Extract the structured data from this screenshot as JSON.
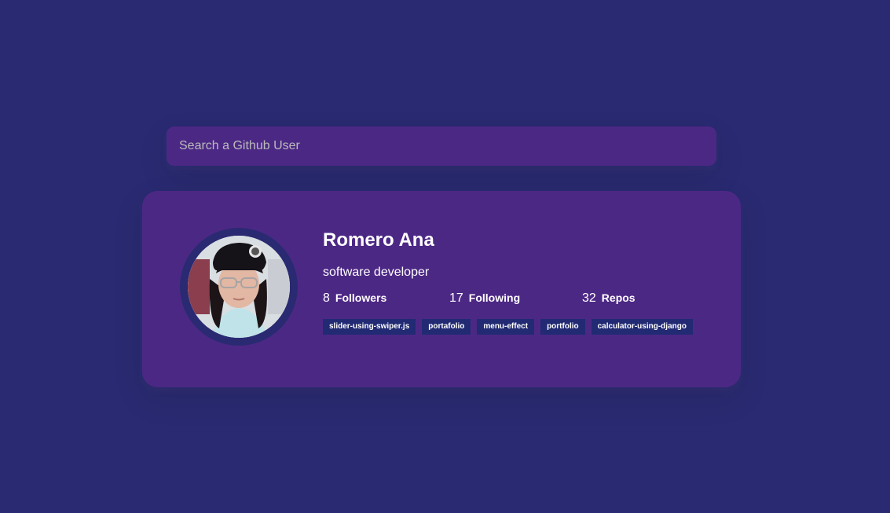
{
  "search": {
    "placeholder": "Search a Github User",
    "value": ""
  },
  "profile": {
    "name": "Romero Ana",
    "bio": "software developer",
    "avatar_icon": "user-avatar-photo",
    "stats": [
      {
        "count": "8",
        "label": "Followers"
      },
      {
        "count": "17",
        "label": "Following"
      },
      {
        "count": "32",
        "label": "Repos"
      }
    ],
    "repos": [
      "slider-using-swiper.js",
      "portafolio",
      "menu-effect",
      "portfolio",
      "calculator-using-django"
    ]
  },
  "colors": {
    "background": "#2a2a72",
    "card": "#4c2885",
    "repo_tag": "#212a72",
    "text": "#ffffff"
  }
}
